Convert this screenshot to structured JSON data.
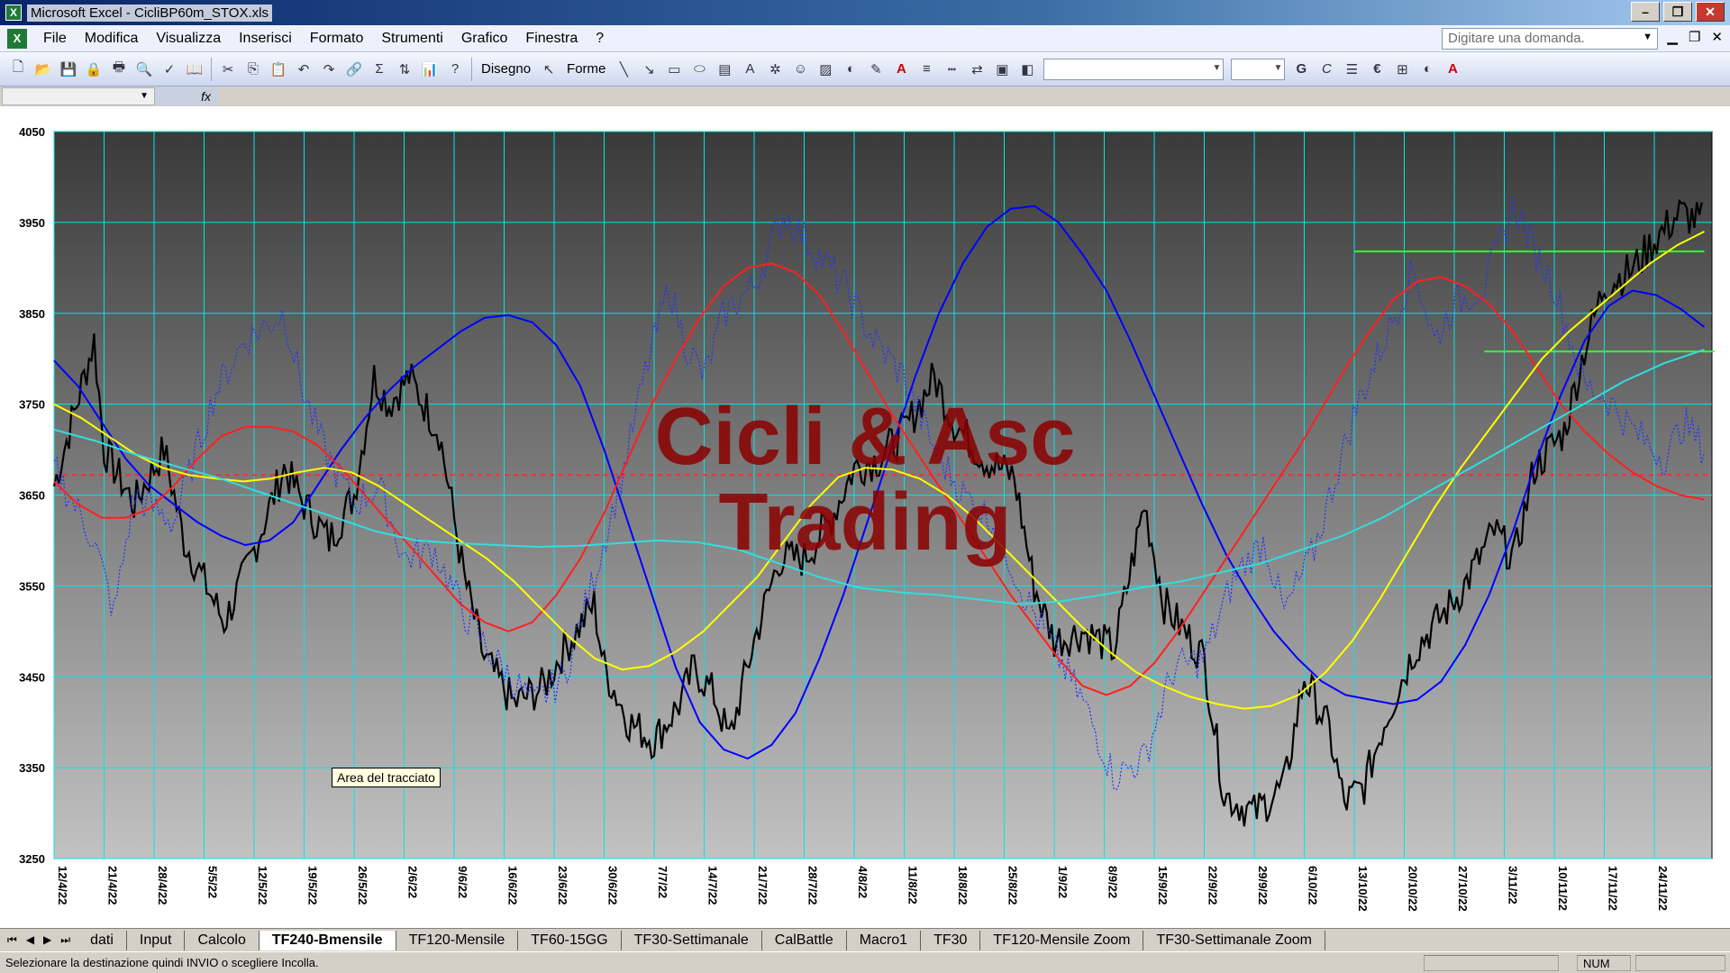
{
  "window": {
    "title": "Microsoft Excel - CicliBP60m_STOX.xls",
    "minimize": "–",
    "maximize": "❐",
    "close": "✕"
  },
  "menu": {
    "items": [
      "File",
      "Modifica",
      "Visualizza",
      "Inserisci",
      "Formato",
      "Strumenti",
      "Grafico",
      "Finestra",
      "?"
    ],
    "help_placeholder": "Digitare una domanda."
  },
  "toolbar": {
    "disegno_label": "Disegno",
    "forme_label": "Forme",
    "bold": "G",
    "italic": "C",
    "euro": "€"
  },
  "formula": {
    "fx": "fx"
  },
  "chart_data": {
    "type": "line",
    "watermark_line1": "Cicli & Asc",
    "watermark_line2": "Trading",
    "y_ticks": [
      "4050",
      "3950",
      "3850",
      "3750",
      "3650",
      "3550",
      "3450",
      "3350",
      "3250"
    ],
    "ylim": [
      3250,
      4050
    ],
    "x_ticks": [
      "12/4/22",
      "21/4/22",
      "28/4/22",
      "5/5/22",
      "12/5/22",
      "19/5/22",
      "26/5/22",
      "2/6/22",
      "9/6/22",
      "16/6/22",
      "23/6/22",
      "30/6/22",
      "7/7/22",
      "14/7/22",
      "21/7/22",
      "28/7/22",
      "4/8/22",
      "11/8/22",
      "18/8/22",
      "25/8/22",
      "1/9/22",
      "8/9/22",
      "15/9/22",
      "22/9/22",
      "29/9/22",
      "6/10/22",
      "13/10/22",
      "20/10/22",
      "27/10/22",
      "3/11/22",
      "10/11/22",
      "17/11/22",
      "24/11/22"
    ],
    "horizontal_refs": [
      {
        "value": 3672,
        "color": "#ff2a2a",
        "style": "dashed"
      },
      {
        "value": 3918,
        "color": "#33ff33",
        "style": "solid",
        "from_index": 26.0,
        "to_index": 33.0
      },
      {
        "value": 3808,
        "color": "#33ff33",
        "style": "solid",
        "from_index": 28.6,
        "to_index": 33.2
      }
    ],
    "series": [
      {
        "color": "#0000ff",
        "values": [
          3798,
          3770,
          3730,
          3690,
          3660,
          3640,
          3620,
          3605,
          3595,
          3600,
          3620,
          3660,
          3700,
          3735,
          3765,
          3790,
          3810,
          3830,
          3845,
          3848,
          3840,
          3815,
          3770,
          3700,
          3620,
          3540,
          3460,
          3400,
          3370,
          3360,
          3375,
          3410,
          3470,
          3540,
          3620,
          3700,
          3780,
          3850,
          3905,
          3945,
          3965,
          3968,
          3950,
          3915,
          3875,
          3820,
          3760,
          3700,
          3640,
          3585,
          3540,
          3500,
          3470,
          3445,
          3430,
          3425,
          3420,
          3425,
          3445,
          3485,
          3540,
          3610,
          3690,
          3760,
          3820,
          3858,
          3875,
          3870,
          3855,
          3835
        ]
      },
      {
        "color": "#ff2020",
        "values": [
          3665,
          3640,
          3625,
          3625,
          3635,
          3660,
          3690,
          3715,
          3725,
          3725,
          3720,
          3705,
          3680,
          3650,
          3620,
          3590,
          3560,
          3530,
          3510,
          3500,
          3510,
          3540,
          3580,
          3630,
          3690,
          3750,
          3800,
          3845,
          3880,
          3900,
          3905,
          3895,
          3870,
          3830,
          3785,
          3740,
          3700,
          3660,
          3620,
          3580,
          3540,
          3505,
          3470,
          3440,
          3430,
          3440,
          3465,
          3500,
          3540,
          3580,
          3620,
          3660,
          3700,
          3745,
          3790,
          3830,
          3865,
          3885,
          3890,
          3880,
          3860,
          3830,
          3790,
          3750,
          3720,
          3695,
          3675,
          3660,
          3650,
          3645
        ]
      },
      {
        "color": "#ffff00",
        "values": [
          3750,
          3735,
          3715,
          3695,
          3680,
          3672,
          3668,
          3665,
          3668,
          3675,
          3680,
          3675,
          3660,
          3640,
          3620,
          3600,
          3580,
          3555,
          3525,
          3495,
          3470,
          3458,
          3462,
          3478,
          3500,
          3530,
          3560,
          3600,
          3640,
          3670,
          3680,
          3678,
          3668,
          3650,
          3625,
          3595,
          3565,
          3535,
          3505,
          3478,
          3455,
          3440,
          3428,
          3420,
          3415,
          3418,
          3430,
          3455,
          3490,
          3535,
          3585,
          3635,
          3680,
          3720,
          3760,
          3800,
          3830,
          3855,
          3880,
          3905,
          3925,
          3940
        ]
      },
      {
        "color": "#33dddd",
        "values": [
          3722,
          3710,
          3695,
          3682,
          3670,
          3655,
          3640,
          3625,
          3610,
          3600,
          3597,
          3595,
          3593,
          3594,
          3597,
          3600,
          3598,
          3590,
          3575,
          3560,
          3548,
          3543,
          3540,
          3535,
          3530,
          3533,
          3540,
          3548,
          3555,
          3565,
          3575,
          3590,
          3605,
          3625,
          3650,
          3675,
          3700,
          3725,
          3750,
          3775,
          3795,
          3810
        ]
      }
    ],
    "price_color": "#000000",
    "dotted_color": "#2233ff",
    "background_top": "#3a3a3a",
    "background_bottom": "#c2c2c2",
    "grid_color": "#00e6e6"
  },
  "tooltip": "Area del tracciato",
  "sheet_tabs": [
    "dati",
    "Input",
    "Calcolo",
    "TF240-Bmensile",
    "TF120-Mensile",
    "TF60-15GG",
    "TF30-Settimanale",
    "CalBattle",
    "Macro1",
    "TF30",
    "TF120-Mensile Zoom",
    "TF30-Settimanale Zoom"
  ],
  "active_tab": "TF240-Bmensile",
  "tab_nav": [
    "⏮",
    "◀",
    "▶",
    "⏭"
  ],
  "status": {
    "message": "Selezionare la destinazione quindi INVIO o scegliere Incolla.",
    "num": "NUM"
  }
}
